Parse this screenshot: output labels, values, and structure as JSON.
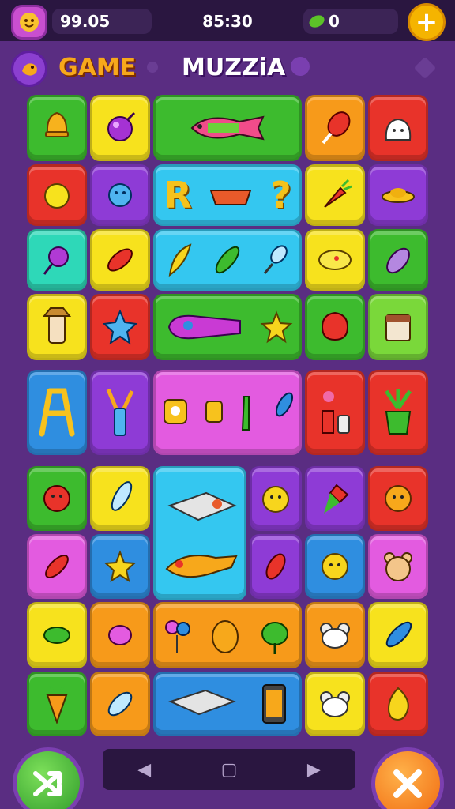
{
  "header": {
    "score": "99.05",
    "timer": "85:30",
    "gems": "0",
    "add_label": "+"
  },
  "subheader": {
    "game_label": "GAME",
    "title": "MUZZiA"
  },
  "colors": {
    "green": "#3dbb2e",
    "yellow": "#f7d51d",
    "orange": "#f79a1a",
    "red": "#e8332a",
    "purple": "#8e3bd6",
    "blue": "#2f8ee0",
    "cyan": "#34c7f0",
    "pink": "#e35be0",
    "lime": "#7ad83a",
    "teal": "#2ed8b8"
  },
  "board": {
    "rows": [
      [
        "bell",
        "candy-orb",
        "fish-wrap",
        "fish-wrap",
        "drumstick",
        "fluffy-cloud",
        "ghost-bunny"
      ],
      [
        "lemon",
        "blue-virus",
        "letter-R",
        "sunglasses",
        "question-mark",
        "carrot",
        "hat"
      ],
      [
        "lollipop",
        "firework",
        "feather",
        "cucumber",
        "magnifier",
        "lemon-slice",
        "eggplant"
      ],
      [
        "tiki-statue",
        "blue-star",
        "purple-gadget",
        "purple-gadget",
        "yellow-star",
        "red-blob",
        "toaster"
      ],
      [
        "easel",
        "paint-tools",
        "toy-figures",
        "toy-figures",
        "toy-figures",
        "flower-pot",
        "plant-pot"
      ],
      [
        "red-blob",
        "feather",
        "laptop",
        "laptop",
        "smiley",
        "ice-cream",
        "sun-face"
      ],
      [
        "leaf",
        "starfish",
        "baked-fish",
        "baked-fish",
        "leaf-red",
        "smiley",
        "teddy-bear"
      ],
      [
        "turtle",
        "candy",
        "balloon-toy",
        "balloon-toy",
        "leaf-green",
        "mouse",
        "kite"
      ],
      [
        "carrot",
        "shell",
        "laptop",
        "laptop",
        "phone",
        "mouse",
        "flame"
      ]
    ],
    "letters": {
      "r": "R",
      "q": "?"
    }
  },
  "question_mark": "?",
  "letter_r": "R"
}
